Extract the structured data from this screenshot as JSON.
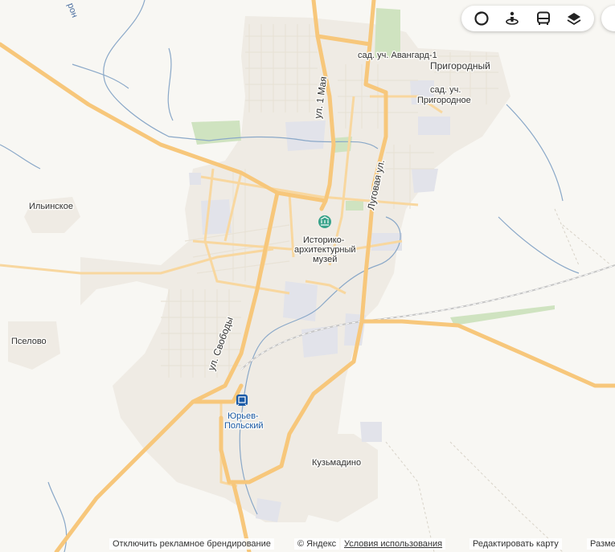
{
  "labels": {
    "street_1maya": "ул. 1 Мая",
    "street_lugovaya": "Луговая ул.",
    "street_svobody": "ул. Свободы",
    "avangard": "сад. уч. Авангард-1",
    "prigorodny": "Пригородный",
    "prigorodnoe_1": "сад. уч.",
    "prigorodnoe_2": "Пригородное",
    "ilinskoe": "Ильинское",
    "pselovo": "Пселово",
    "museum_1": "Историко-",
    "museum_2": "архитектурный",
    "museum_3": "музей",
    "station_1": "Юрьев-",
    "station_2": "Польский",
    "kuzmadino": "Кузьмадино",
    "river": "рон"
  },
  "toolbar": {
    "buttons": [
      "layers-circle-icon",
      "panorama-person-icon",
      "transport-bus-icon",
      "map-layers-icon"
    ]
  },
  "footer": {
    "ads": "Отключить рекламное брендирование",
    "copyright": "© Яндекс",
    "terms": "Условия использования",
    "edit": "Редактировать карту",
    "place": "Разместить"
  },
  "colors": {
    "road_main": "#f7c77b",
    "road_minor": "#f8d79f",
    "water": "#8aa8c8",
    "park": "#cfe3c0",
    "industrial": "#e2e3ea",
    "town": "#efebe4",
    "museum": "#3aa38b",
    "station": "#1a5aa6"
  }
}
